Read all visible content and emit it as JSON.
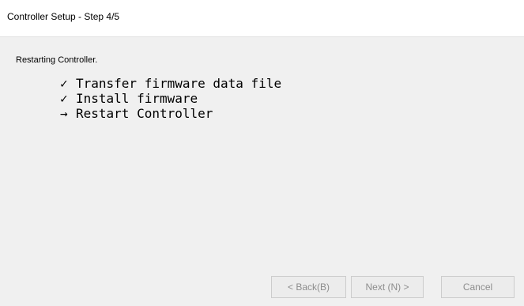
{
  "window": {
    "title": "Controller Setup - Step 4/5"
  },
  "main": {
    "status": "Restarting Controller.",
    "steps": [
      {
        "mark": "✓",
        "label": "Transfer firmware data file",
        "state": "done"
      },
      {
        "mark": "✓",
        "label": "Install firmware",
        "state": "done"
      },
      {
        "mark": "→",
        "label": "Restart Controller",
        "state": "in-progress"
      }
    ]
  },
  "buttons": {
    "back": "< Back(B)",
    "next": "Next (N) >",
    "cancel": "Cancel"
  },
  "colors": {
    "window_bg": "#f0f0f0",
    "titlebar_bg": "#ffffff",
    "disabled_text": "#8d8d8d",
    "disabled_border": "#cccccc"
  }
}
